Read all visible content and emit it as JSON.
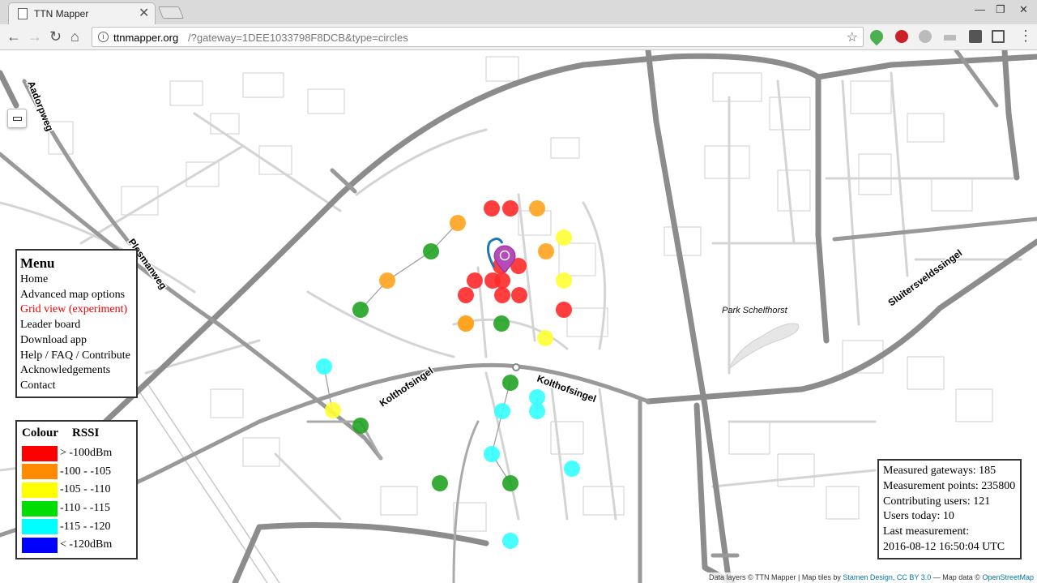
{
  "browser": {
    "tab_title": "TTN Mapper",
    "tab_close": "✕",
    "url_host": "ttnmapper.org",
    "url_path": "/?gateway=1DEE1033798F8DCB&type=circles",
    "back": "←",
    "forward": "→",
    "reload": "↻",
    "home": "⌂",
    "star": "☆",
    "menu_icon": "⋮",
    "window_minimize": "—",
    "window_maximize": "❐",
    "window_close": "✕"
  },
  "map": {
    "road_labels": [
      "Aadorpweg",
      "Plesmanweg",
      "Kolthofsingel",
      "Kolthofsingel",
      "Sluitersveldssingel"
    ],
    "park_label": "Park Schelfhorst",
    "colors": {
      "red": "#ff0000",
      "orange": "#ff8c00",
      "yellow": "#ffff00",
      "green": "#00b000",
      "cyan": "#00ffff",
      "blue": "#0000ff",
      "marker": "#b64ab9"
    },
    "measurements": [
      {
        "id": 1,
        "rssi_class": "red"
      },
      {
        "id": 2,
        "rssi_class": "red"
      },
      {
        "id": 3,
        "rssi_class": "orange"
      },
      {
        "id": 4,
        "rssi_class": "orange"
      },
      {
        "id": 5,
        "rssi_class": "yellow"
      },
      {
        "id": 6,
        "rssi_class": "green"
      },
      {
        "id": 7,
        "rssi_class": "orange"
      },
      {
        "id": 8,
        "rssi_class": "red"
      },
      {
        "id": 9,
        "rssi_class": "orange"
      },
      {
        "id": 10,
        "rssi_class": "orange"
      },
      {
        "id": 11,
        "rssi_class": "red"
      },
      {
        "id": 12,
        "rssi_class": "red"
      },
      {
        "id": 13,
        "rssi_class": "red"
      },
      {
        "id": 14,
        "rssi_class": "red"
      },
      {
        "id": 15,
        "rssi_class": "yellow"
      },
      {
        "id": 16,
        "rssi_class": "red"
      },
      {
        "id": 17,
        "rssi_class": "red"
      },
      {
        "id": 18,
        "rssi_class": "red"
      },
      {
        "id": 19,
        "rssi_class": "green"
      },
      {
        "id": 20,
        "rssi_class": "red"
      },
      {
        "id": 21,
        "rssi_class": "orange"
      },
      {
        "id": 22,
        "rssi_class": "green"
      },
      {
        "id": 23,
        "rssi_class": "yellow"
      },
      {
        "id": 24,
        "rssi_class": "cyan"
      },
      {
        "id": 25,
        "rssi_class": "green"
      },
      {
        "id": 26,
        "rssi_class": "cyan"
      },
      {
        "id": 27,
        "rssi_class": "cyan"
      },
      {
        "id": 28,
        "rssi_class": "cyan"
      },
      {
        "id": 29,
        "rssi_class": "yellow"
      },
      {
        "id": 30,
        "rssi_class": "green"
      },
      {
        "id": 31,
        "rssi_class": "cyan"
      },
      {
        "id": 32,
        "rssi_class": "cyan"
      },
      {
        "id": 33,
        "rssi_class": "green"
      },
      {
        "id": 34,
        "rssi_class": "green"
      },
      {
        "id": 35,
        "rssi_class": "cyan"
      }
    ]
  },
  "menu": {
    "title": "Menu",
    "items": [
      {
        "label": "Home",
        "active": false
      },
      {
        "label": "Advanced map options",
        "active": false
      },
      {
        "label": "Grid view (experiment)",
        "active": true
      },
      {
        "label": "Leader board",
        "active": false
      },
      {
        "label": "Download app",
        "active": false
      },
      {
        "label": "Help / FAQ / Contribute",
        "active": false
      },
      {
        "label": "Acknowledgements",
        "active": false
      },
      {
        "label": "Contact",
        "active": false
      }
    ]
  },
  "legend": {
    "col_colour": "Colour",
    "col_rssi": "RSSI",
    "rows": [
      {
        "color": "#ff0000",
        "label": "> -100dBm"
      },
      {
        "color": "#ff8c00",
        "label": "-100 - -105"
      },
      {
        "color": "#ffff00",
        "label": "-105 - -110"
      },
      {
        "color": "#00dd00",
        "label": "-110 - -115"
      },
      {
        "color": "#00ffff",
        "label": "-115 - -120"
      },
      {
        "color": "#0000ff",
        "label": "< -120dBm"
      }
    ]
  },
  "stats": {
    "lines": [
      "Measured gateways: 185",
      "Measurement points: 235800",
      "Contributing users: 121",
      "Users today: 10",
      "Last measurement:",
      "2016-08-12 16:50:04 UTC"
    ]
  },
  "attribution": {
    "prefix": "Data layers © TTN Mapper | Map tiles by ",
    "stamen": "Stamen Design",
    "comma": ", ",
    "license": "CC BY 3.0",
    "mid": " — Map data © ",
    "osm": "OpenStreetMap"
  }
}
